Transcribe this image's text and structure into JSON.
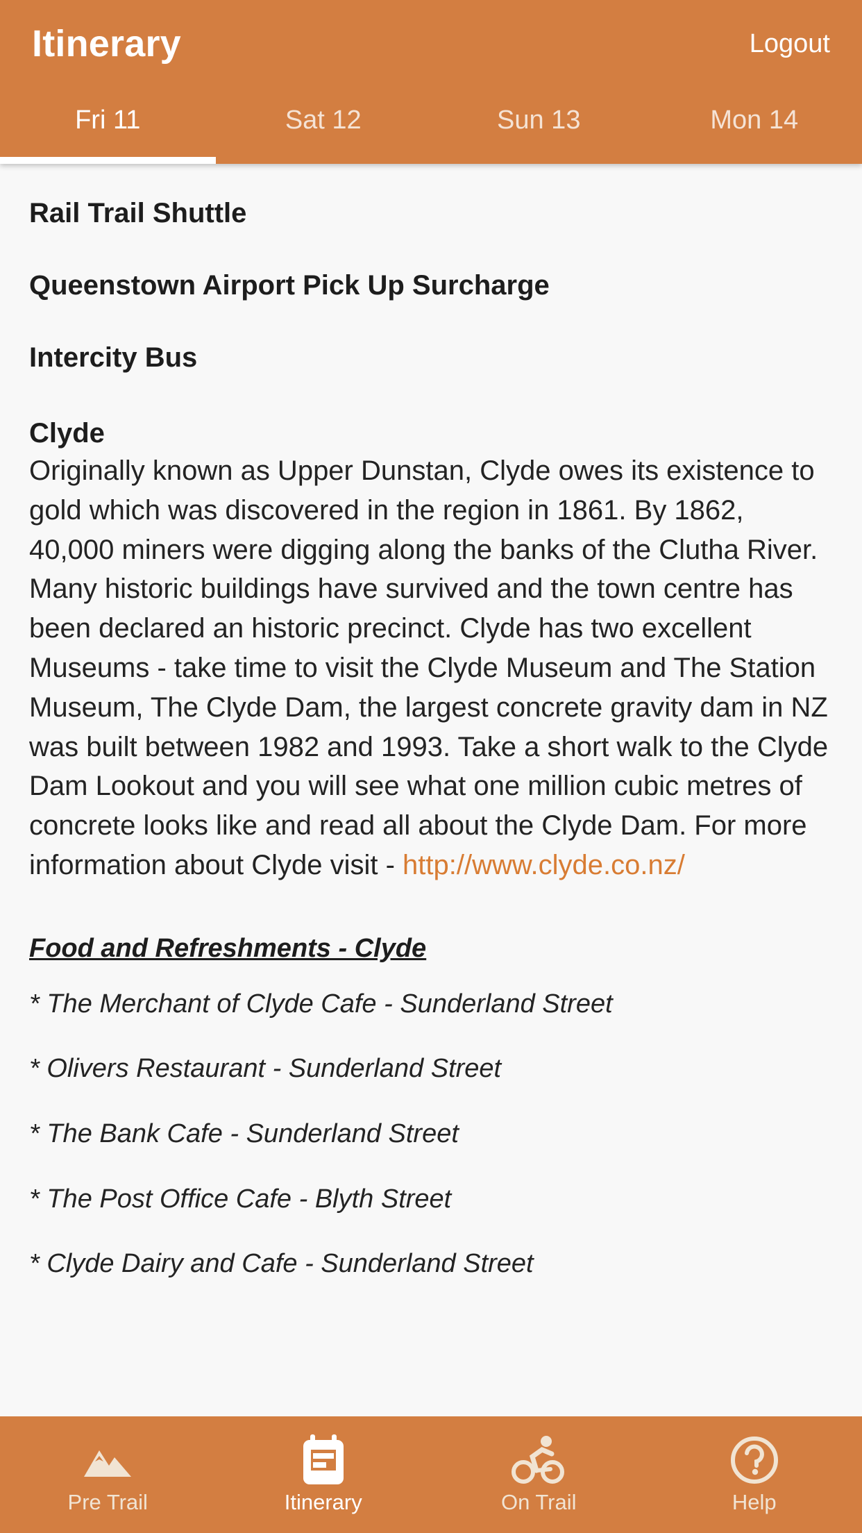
{
  "theme": {
    "accent": "#d37e41",
    "accent_link": "#d87c33",
    "content_bg": "#f8f8f8",
    "text": "#232323",
    "on_accent": "#ffffff",
    "on_accent_dim": "#f1e4d3"
  },
  "header": {
    "title": "Itinerary",
    "logout_label": "Logout"
  },
  "tabs": [
    {
      "label": "Fri 11",
      "active": true
    },
    {
      "label": "Sat 12",
      "active": false
    },
    {
      "label": "Sun 13",
      "active": false
    },
    {
      "label": "Mon 14",
      "active": false
    }
  ],
  "main": {
    "items": [
      {
        "title": "Rail Trail Shuttle"
      },
      {
        "title": "Queenstown Airport Pick Up Surcharge"
      },
      {
        "title": "Intercity Bus"
      }
    ],
    "section": {
      "heading": "Clyde",
      "body_before_link": "Originally known as Upper Dunstan, Clyde owes its existence to gold which was discovered in the region in 1861. By 1862, 40,000 miners were digging along the banks of the Clutha River. Many historic buildings have survived and the town centre has been declared an historic precinct. Clyde has two excellent Museums - take time to visit the Clyde Museum and The Station Museum, The Clyde Dam, the largest concrete gravity dam in NZ was built between 1982 and 1993. Take a short walk to the Clyde Dam Lookout and you will see what one million cubic metres of concrete looks like and read all about the Clyde Dam. For more information about Clyde visit - ",
      "link_text": "http://www.clyde.co.nz/"
    },
    "food": {
      "heading": "Food and Refreshments - Clyde",
      "items": [
        "* The Merchant of Clyde Cafe - Sunderland Street",
        "* Olivers Restaurant - Sunderland Street",
        "* The Bank Cafe - Sunderland Street",
        "* The Post Office Cafe - Blyth Street",
        "* Clyde Dairy and Cafe - Sunderland Street"
      ]
    }
  },
  "bottom_nav": [
    {
      "label": "Pre Trail",
      "icon": "mountain-icon",
      "active": false
    },
    {
      "label": "Itinerary",
      "icon": "clipboard-icon",
      "active": true
    },
    {
      "label": "On Trail",
      "icon": "cyclist-icon",
      "active": false
    },
    {
      "label": "Help",
      "icon": "question-circle-icon",
      "active": false
    }
  ]
}
